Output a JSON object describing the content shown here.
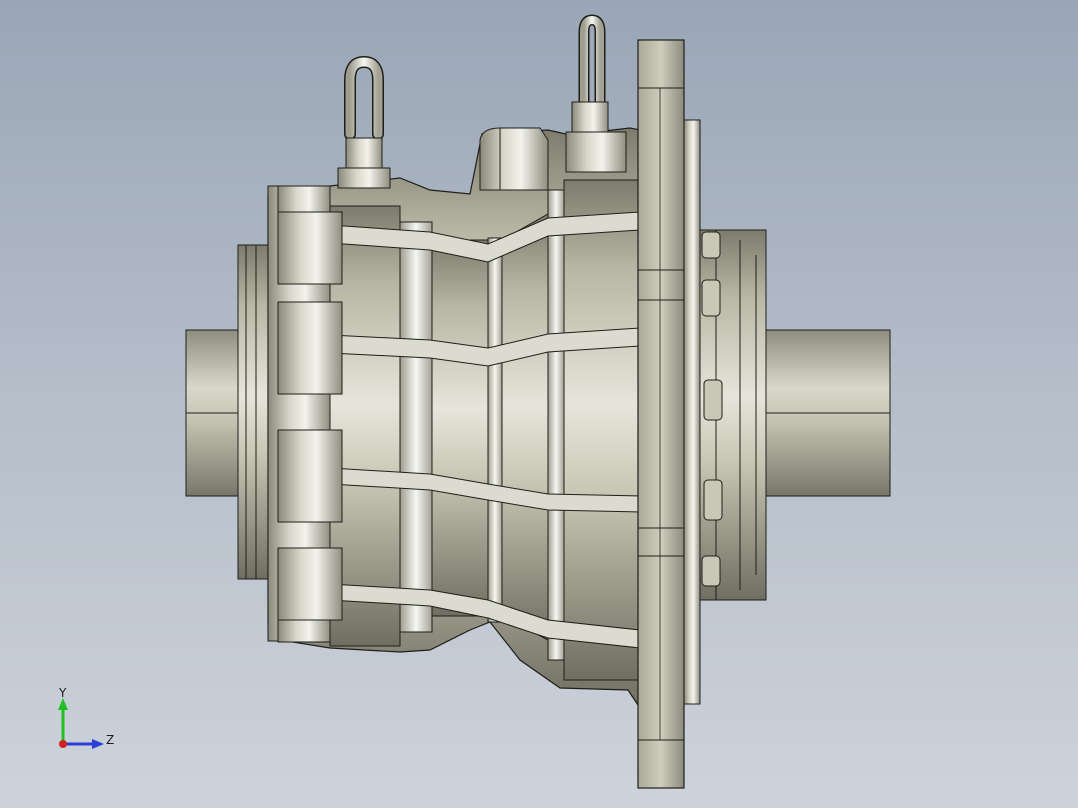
{
  "viewport": {
    "background_top": "#9aa6b6",
    "background_bottom": "#cdd3db"
  },
  "model": {
    "body_color": "#c6c5b3",
    "edge_color": "#1e1e1a",
    "shadow_color": "#6d6c60",
    "highlight_color": "#f2f2ec"
  },
  "triad": {
    "y_label": "Y",
    "z_label": "Z",
    "y_color": "#23c023",
    "z_color": "#2a3fd6",
    "x_color": "#d42020"
  }
}
